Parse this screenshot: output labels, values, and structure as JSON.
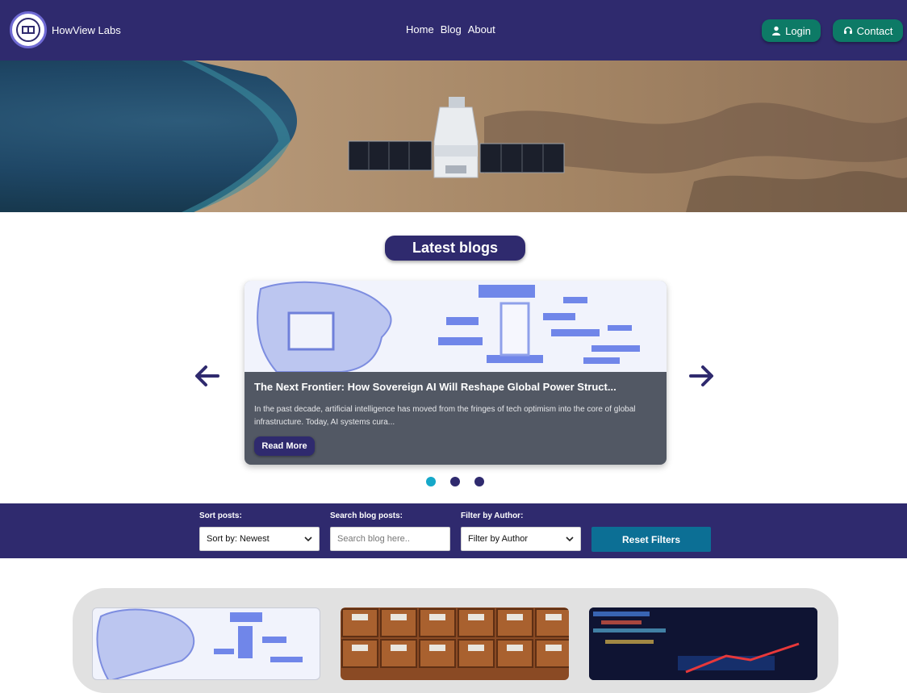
{
  "header": {
    "brand_name": "HowView Labs",
    "nav": [
      "Home",
      "Blog",
      "About"
    ],
    "login_label": "Login",
    "contact_label": "Contact"
  },
  "latest": {
    "heading": "Latest blogs",
    "featured": {
      "title": "The Next Frontier: How Sovereign AI Will Reshape Global Power Struct...",
      "excerpt": "In the past decade, artificial intelligence has moved from the fringes of tech optimism into the core of global infrastructure. Today, AI systems cura...",
      "cta": "Read More"
    },
    "carousel_dots": 3,
    "active_dot": 0
  },
  "filters": {
    "sort_label": "Sort posts:",
    "sort_value": "Sort by: Newest",
    "search_label": "Search blog posts:",
    "search_placeholder": "Search blog here..",
    "author_label": "Filter by Author:",
    "author_value": "Filter by Author",
    "reset_label": "Reset Filters"
  },
  "colors": {
    "brand": "#2f2a6e",
    "accent_green": "#0d7a66",
    "active_dot": "#15a8c9"
  }
}
